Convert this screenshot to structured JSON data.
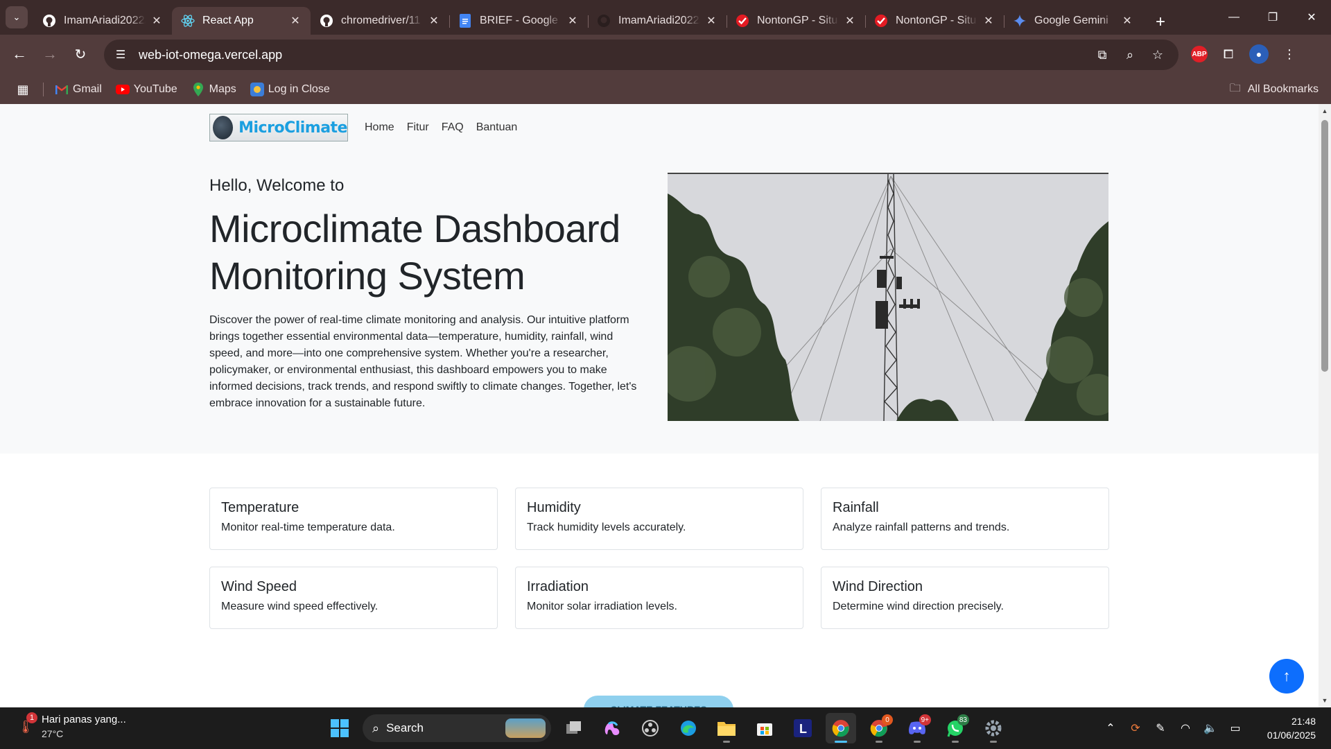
{
  "browser": {
    "tabs": [
      {
        "title": "ImamAriadi2022/",
        "favicon": "github-icon",
        "active": false
      },
      {
        "title": "React App",
        "favicon": "react-icon",
        "active": true
      },
      {
        "title": "chromedriver/11",
        "favicon": "github-icon",
        "active": false
      },
      {
        "title": "BRIEF - Google D",
        "favicon": "google-docs-icon",
        "active": false
      },
      {
        "title": "ImamAriadi2022/",
        "favicon": "github-icon",
        "active": false
      },
      {
        "title": "NontonGP - Situ",
        "favicon": "check-icon",
        "active": false
      },
      {
        "title": "NontonGP - Situ",
        "favicon": "check-icon",
        "active": false
      },
      {
        "title": "Google Gemini",
        "favicon": "gemini-icon",
        "active": false
      }
    ],
    "url": "web-iot-omega.vercel.app",
    "bookmarks": [
      {
        "label": "Gmail",
        "icon": "gmail-icon"
      },
      {
        "label": "YouTube",
        "icon": "youtube-icon"
      },
      {
        "label": "Maps",
        "icon": "maps-icon"
      },
      {
        "label": "Log in Close",
        "icon": "close-app-icon"
      }
    ],
    "all_bookmarks": "All Bookmarks",
    "extension_abp": "ABP"
  },
  "site": {
    "brand": "MicroClimate",
    "nav": [
      "Home",
      "Fitur",
      "FAQ",
      "Bantuan"
    ],
    "hero": {
      "greeting": "Hello, Welcome to",
      "title_line1": "Microclimate Dashboard",
      "title_line2": "Monitoring System",
      "description": "Discover the power of real-time climate monitoring and analysis. Our intuitive platform brings together essential environmental data—temperature, humidity, rainfall, wind speed, and more—into one comprehensive system. Whether you're a researcher, policymaker, or environmental enthusiast, this dashboard empowers you to make informed decisions, track trends, and respond swiftly to climate changes. Together, let's embrace innovation for a sustainable future."
    },
    "features": [
      {
        "title": "Temperature",
        "desc": "Monitor real-time temperature data."
      },
      {
        "title": "Humidity",
        "desc": "Track humidity levels accurately."
      },
      {
        "title": "Rainfall",
        "desc": "Analyze rainfall patterns and trends."
      },
      {
        "title": "Wind Speed",
        "desc": "Measure wind speed effectively."
      },
      {
        "title": "Irradiation",
        "desc": "Monitor solar irradiation levels."
      },
      {
        "title": "Wind Direction",
        "desc": "Determine wind direction precisely."
      }
    ],
    "more_button": "CLIMATE FEATURES",
    "accent": "#0d6efd",
    "brand_color": "#1b9fe0"
  },
  "taskbar": {
    "weather_text": "Hari panas yang...",
    "weather_temp": "27°C",
    "weather_badge": "1",
    "search_label": "Search",
    "badges": {
      "chrome_alt": "0",
      "discord": "9+",
      "whatsapp": "83"
    },
    "time": "21:48",
    "date": "01/06/2025"
  }
}
